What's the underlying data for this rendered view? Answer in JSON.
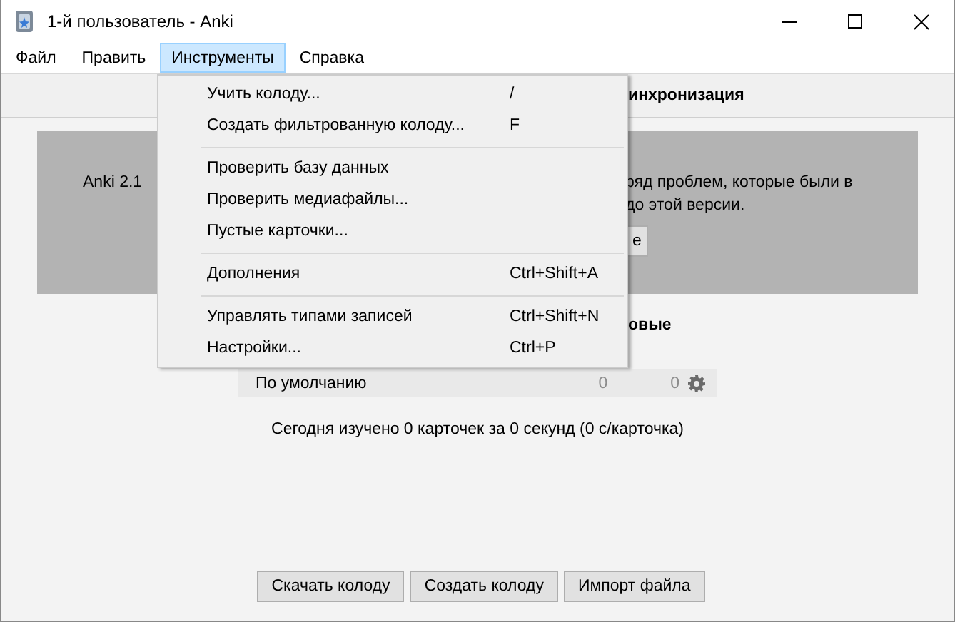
{
  "window": {
    "title": "1-й пользователь - Anki"
  },
  "menubar": [
    {
      "label": "Файл",
      "selected": false
    },
    {
      "label": "Править",
      "selected": false
    },
    {
      "label": "Инструменты",
      "selected": true
    },
    {
      "label": "Справка",
      "selected": false
    }
  ],
  "open_menu": {
    "groups": [
      [
        {
          "label": "Учить колоду...",
          "shortcut": "/"
        },
        {
          "label": "Создать фильтрованную колоду...",
          "shortcut": "F"
        }
      ],
      [
        {
          "label": "Проверить базу данных"
        },
        {
          "label": "Проверить медиафайлы..."
        },
        {
          "label": "Пустые карточки..."
        }
      ],
      [
        {
          "label": "Дополнения",
          "shortcut": "Ctrl+Shift+A"
        }
      ],
      [
        {
          "label": "Управлять типами записей",
          "shortcut": "Ctrl+Shift+N"
        },
        {
          "label": "Настройки...",
          "shortcut": "Ctrl+P"
        }
      ]
    ]
  },
  "toolbar": {
    "label": "инхронизация"
  },
  "banner": {
    "text_left": "Anki 2.1",
    "text_right": [
      "ряд проблем, которые были в",
      "до этой версии."
    ],
    "button": "е"
  },
  "deck_list": {
    "column_header": "овые",
    "decks": [
      {
        "name": "По умолчанию",
        "count_1": "0",
        "count_2": "0"
      }
    ]
  },
  "stats": "Сегодня изучено 0 карточек за 0 секунд (0 с/карточка)",
  "buttons": [
    "Скачать колоду",
    "Создать колоду",
    "Импорт файла"
  ]
}
